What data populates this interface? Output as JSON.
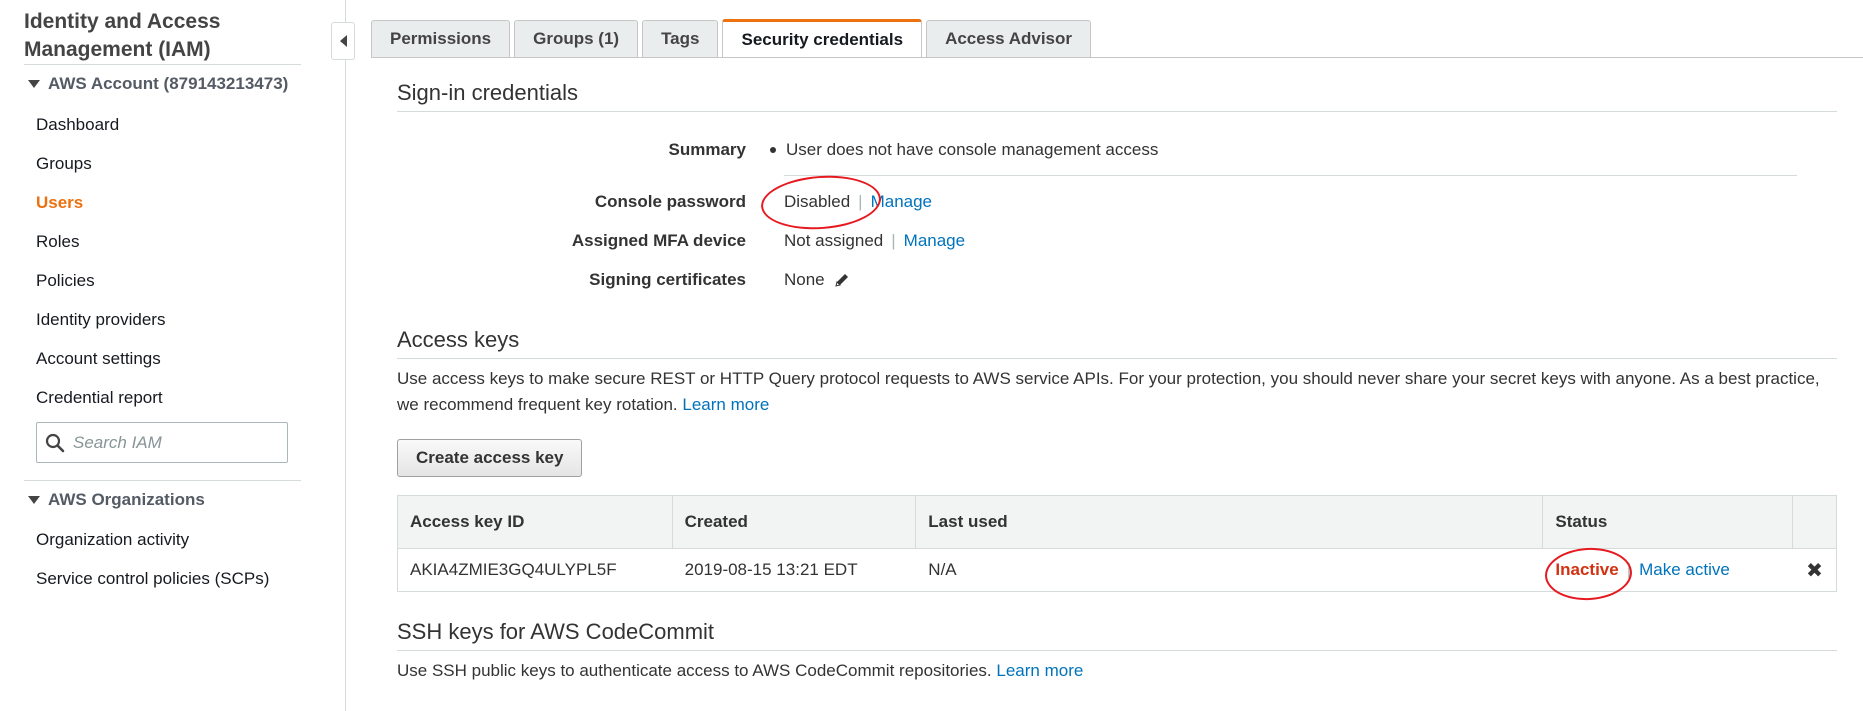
{
  "sidebar": {
    "title": "Identity and Access Management (IAM)",
    "account_label": "AWS Account (879143213473)",
    "items": [
      {
        "label": "Dashboard"
      },
      {
        "label": "Groups"
      },
      {
        "label": "Users",
        "active": true
      },
      {
        "label": "Roles"
      },
      {
        "label": "Policies"
      },
      {
        "label": "Identity providers"
      },
      {
        "label": "Account settings"
      },
      {
        "label": "Credential report"
      }
    ],
    "search_placeholder": "Search IAM",
    "org_label": "AWS Organizations",
    "org_items": [
      {
        "label": "Organization activity"
      },
      {
        "label": "Service control policies (SCPs)"
      }
    ]
  },
  "tabs": [
    {
      "label": "Permissions"
    },
    {
      "label": "Groups (1)"
    },
    {
      "label": "Tags"
    },
    {
      "label": "Security credentials",
      "active": true
    },
    {
      "label": "Access Advisor"
    }
  ],
  "signin": {
    "heading": "Sign-in credentials",
    "summary_label": "Summary",
    "summary_value": "User does not have console management access",
    "console_password_label": "Console password",
    "console_password_value": "Disabled",
    "console_password_link": "Manage",
    "mfa_label": "Assigned MFA device",
    "mfa_value": "Not assigned",
    "mfa_link": "Manage",
    "signing_label": "Signing certificates",
    "signing_value": "None"
  },
  "access_keys": {
    "heading": "Access keys",
    "description": "Use access keys to make secure REST or HTTP Query protocol requests to AWS service APIs. For your protection, you should never share your secret keys with anyone. As a best practice, we recommend frequent key rotation.",
    "learn_more": "Learn more",
    "create_button": "Create access key",
    "columns": [
      "Access key ID",
      "Created",
      "Last used",
      "Status"
    ],
    "rows": [
      {
        "id": "AKIA4ZMIE3GQ4ULYPL5F",
        "created": "2019-08-15 13:21 EDT",
        "last_used": "N/A",
        "status": "Inactive",
        "action": "Make active"
      }
    ]
  },
  "ssh": {
    "heading": "SSH keys for AWS CodeCommit",
    "description": "Use SSH public keys to authenticate access to AWS CodeCommit repositories.",
    "learn_more": "Learn more"
  },
  "colors": {
    "accent": "#ec7211",
    "link": "#0073bb",
    "inactive": "#d13212",
    "annotation": "#e5191f"
  }
}
